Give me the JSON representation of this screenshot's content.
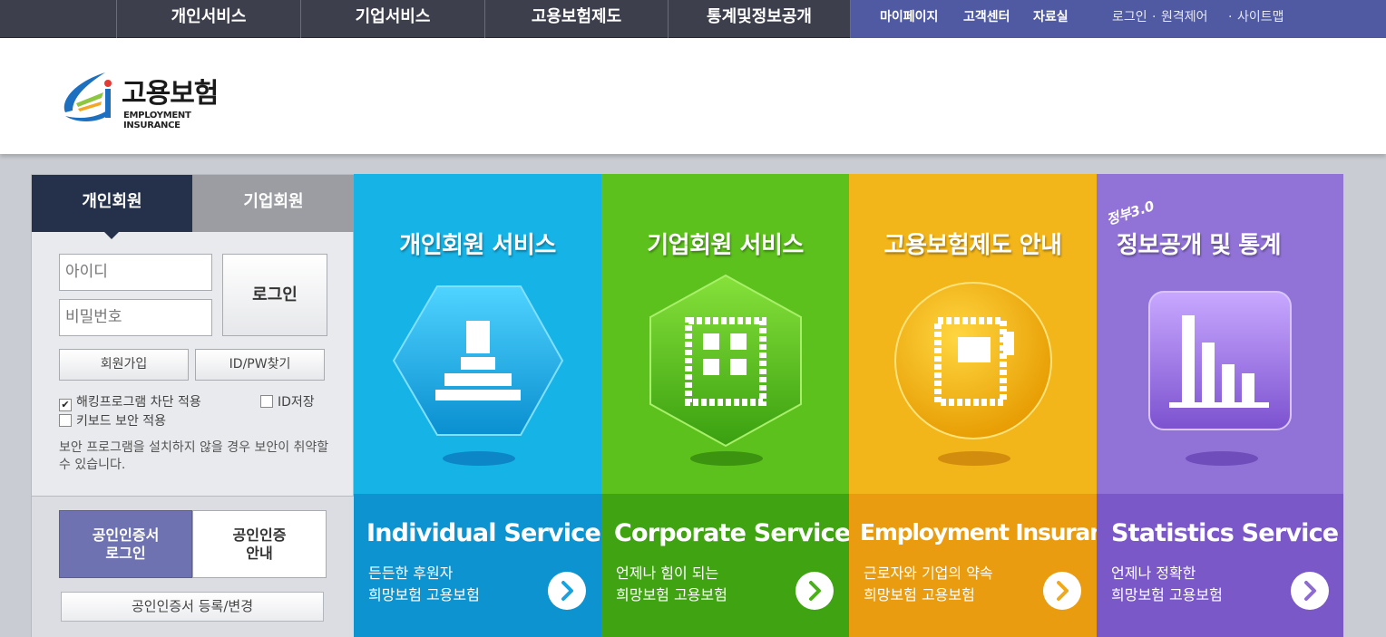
{
  "topnav": {
    "items": [
      "개인서비스",
      "기업서비스",
      "고용보험제도",
      "통계및정보공개"
    ],
    "util_items": [
      "마이페이지",
      "고객센터",
      "자료실"
    ],
    "links": [
      "로그인",
      "원격제어",
      "사이트맵"
    ]
  },
  "logo": {
    "name": "고용보험",
    "subtitle": "EMPLOYMENT INSURANCE"
  },
  "login": {
    "tab_personal": "개인회원",
    "tab_corp": "기업회원",
    "id_placeholder": "아이디",
    "pw_placeholder": "비밀번호",
    "login_button": "로그인",
    "join_button": "회원가입",
    "find_button": "ID/PW찾기",
    "hacking_block": "해킹프로그램 차단 적용",
    "id_save": "ID저장",
    "keyboard_security": "키보드 보안 적용",
    "notice": "보안 프로그램을 설치하지 않을 경우 보안이 취약할 수 있습니다.",
    "cert_login_line1": "공인인증서",
    "cert_login_line2": "로그인",
    "cert_info_line1": "공인인증",
    "cert_info_line2": "안내",
    "cert_register": "공인인증서 등록/변경"
  },
  "cards": [
    {
      "title": "개인회원 서비스",
      "en": "Individual Service",
      "desc1": "든든한 후원자",
      "desc2": "희망보험 고용보험",
      "top_color": "#16b3e6",
      "bottom_color": "#0d93cf",
      "arrow_color": "#17a3e0"
    },
    {
      "title": "기업회원 서비스",
      "en": "Corporate Service",
      "desc1": "언제나 힘이 되는",
      "desc2": "희망보험 고용보험",
      "top_color": "#5cc11c",
      "bottom_color": "#3fa312",
      "arrow_color": "#49b01a"
    },
    {
      "title": "고용보험제도 안내",
      "en": "Employment Insurance",
      "desc1": "근로자와 기업의 약속",
      "desc2": "희망보험 고용보험",
      "top_color": "#f2b51a",
      "bottom_color": "#e99c10",
      "arrow_color": "#f0a91a"
    },
    {
      "title": "정보공개 및 통계",
      "title_prefix": "정부3.0",
      "en": "Statistics Service",
      "desc1": "언제나 정확한",
      "desc2": "희망보험 고용보험",
      "top_color": "#9173d8",
      "bottom_color": "#7a58c7",
      "arrow_color": "#8d6bd3"
    }
  ]
}
